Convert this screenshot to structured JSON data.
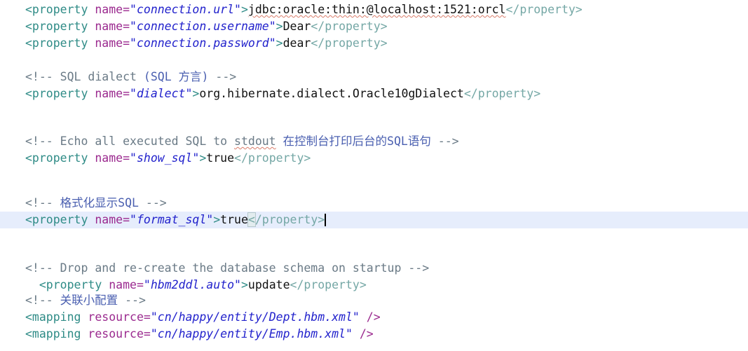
{
  "editor": {
    "kind": "xml-code-editor",
    "file_language": "XML",
    "font_size_px": 16.5,
    "line_height_px": 24,
    "gutter": "none",
    "background_color": "#ffffff",
    "current_line_highlight_color": "#e6edfc",
    "caret_color": "#000000",
    "colors": {
      "tag": "#2e8b86",
      "attribute_name": "#9b2a8f",
      "attribute_value_string": "#2222cc",
      "element_text": "#111111",
      "comment": "#6a7a86",
      "comment_cjk": "#4a5fb0",
      "closing_tag": "#74a7a5",
      "spellcheck_squiggle": "#d97c6a",
      "bracket_match_box": "#e2ecef"
    },
    "caret_line_index": 11,
    "caret_at_end_of_line": true,
    "lines": [
      {
        "index": 0,
        "kind": "property",
        "indent": "",
        "open_tag": "<property",
        "attr_name": "name=",
        "attr_value": "\"connection.url\"",
        "gt": ">",
        "value": "jdbc:oracle:thin:@localhost:1521:orcl",
        "close_tag": "</property>",
        "spellcheck_words": [
          "jdbc",
          "oracle",
          "localhost",
          "orcl"
        ]
      },
      {
        "index": 1,
        "kind": "property",
        "indent": "",
        "open_tag": "<property",
        "attr_name": "name=",
        "attr_value": "\"connection.username\"",
        "gt": ">",
        "value": "Dear",
        "close_tag": "</property>"
      },
      {
        "index": 2,
        "kind": "property",
        "indent": "",
        "open_tag": "<property",
        "attr_name": "name=",
        "attr_value": "\"connection.password\"",
        "gt": ">",
        "value": "dear",
        "close_tag": "</property>"
      },
      {
        "index": 3,
        "kind": "blank"
      },
      {
        "index": 4,
        "kind": "comment",
        "indent": "",
        "comment_open": "<!-- SQL dialect ",
        "comment_cjk": "(SQL 方言)",
        "comment_close": " -->"
      },
      {
        "index": 5,
        "kind": "property",
        "indent": "",
        "open_tag": "<property",
        "attr_name": "name=",
        "attr_value": "\"dialect\"",
        "gt": ">",
        "value": "org.hibernate.dialect.Oracle10gDialect",
        "close_tag": "</property>"
      },
      {
        "index": 6,
        "kind": "blank"
      },
      {
        "index": 7,
        "kind": "blank"
      },
      {
        "index": 8,
        "kind": "comment",
        "indent": "",
        "comment_open": "<!-- Echo all executed SQL to ",
        "comment_spell": "stdout",
        "comment_cjk": " 在控制台打印后台的SQL语句",
        "comment_close": " -->"
      },
      {
        "index": 9,
        "kind": "property",
        "indent": "",
        "open_tag": "<property",
        "attr_name": "name=",
        "attr_value": "\"show_sql\"",
        "gt": ">",
        "value": "true",
        "close_tag": "</property>"
      },
      {
        "index": 10,
        "kind": "blank"
      },
      {
        "index": 11,
        "kind": "blank"
      },
      {
        "index": 12,
        "kind": "comment",
        "indent": "",
        "comment_open": "<!-- ",
        "comment_cjk": "格式化显示SQL",
        "comment_close": " -->"
      },
      {
        "index": 13,
        "kind": "property",
        "current": true,
        "indent": "",
        "open_tag": "<property",
        "attr_name": "name=",
        "attr_value": "\"format_sql\"",
        "gt": ">",
        "value": "true",
        "close_bracket": "<",
        "close_rest": "/property>",
        "bracket_matched": true,
        "caret": true
      },
      {
        "index": 14,
        "kind": "blank"
      },
      {
        "index": 15,
        "kind": "blank"
      },
      {
        "index": 16,
        "kind": "comment",
        "indent": "",
        "comment_open": "<!-- Drop and re-create the database schema on startup -->"
      },
      {
        "index": 17,
        "kind": "property",
        "indent": "  ",
        "open_tag": "<property",
        "attr_name": "name=",
        "attr_value": "\"hbm2ddl.auto\"",
        "gt": ">",
        "value": "update",
        "close_tag": "</property>"
      },
      {
        "index": 18,
        "kind": "comment",
        "indent": "",
        "comment_open": "<!-- ",
        "comment_cjk": "关联小配置",
        "comment_close": " -->"
      },
      {
        "index": 19,
        "kind": "mapping",
        "indent": "",
        "open_tag": "<mapping",
        "attr_name": "resource=",
        "attr_value": "\"cn/happy/entity/Dept.hbm.xml\"",
        "selfclose": " />"
      },
      {
        "index": 20,
        "kind": "mapping",
        "indent": "",
        "open_tag": "<mapping",
        "attr_name": "resource=",
        "attr_value": "\"cn/happy/entity/Emp.hbm.xml\"",
        "selfclose": " />"
      }
    ]
  }
}
